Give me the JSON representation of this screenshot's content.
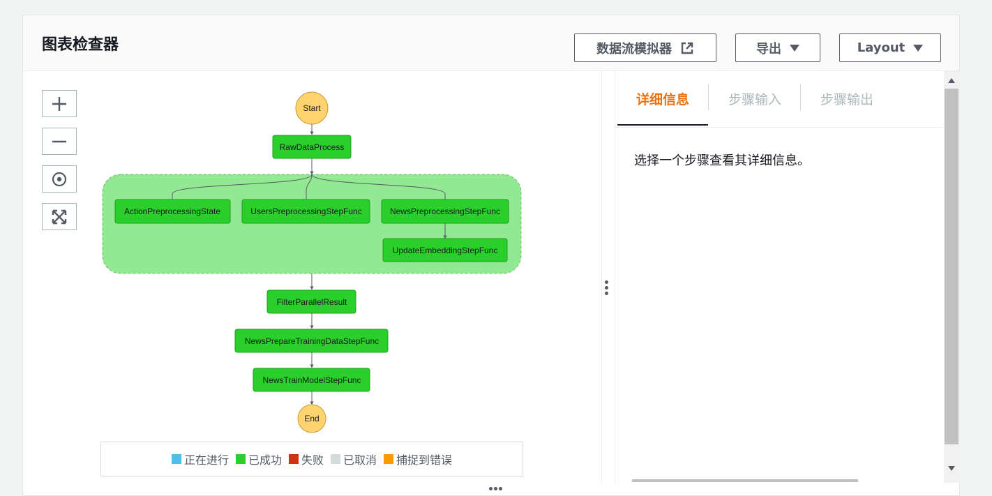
{
  "header": {
    "title": "图表检查器",
    "simulator_button": "数据流模拟器",
    "export_button": "导出",
    "layout_button": "Layout"
  },
  "zoom_controls": {
    "zoom_in_icon": "plus-icon",
    "zoom_out_icon": "minus-icon",
    "center_icon": "target-icon",
    "fit_icon": "expand-icon"
  },
  "graph": {
    "start": "Start",
    "end": "End",
    "nodes": {
      "raw": "RawDataProcess",
      "action": "ActionPreprocessingState",
      "users": "UsersPreprocessingStepFunc",
      "news": "NewsPreprocessingStepFunc",
      "update": "UpdateEmbeddingStepFunc",
      "filter": "FilterParallelResult",
      "prepare": "NewsPrepareTrainingDataStepFunc",
      "train": "NewsTrainModelStepFunc"
    }
  },
  "legend": {
    "items": [
      {
        "label": "正在进行",
        "color": "#4ec0e8"
      },
      {
        "label": "已成功",
        "color": "#2bcf2b"
      },
      {
        "label": "失败",
        "color": "#d13212"
      },
      {
        "label": "已取消",
        "color": "#d5dbdb"
      },
      {
        "label": "捕捉到错误",
        "color": "#ff9900"
      }
    ]
  },
  "details": {
    "tabs": [
      "详细信息",
      "步骤输入",
      "步骤输出"
    ],
    "empty_text": "选择一个步骤查看其详细信息。"
  },
  "colors": {
    "success_node": "#2bcf2b",
    "parallel_bg": "#93e893",
    "terminal": "#ffd470",
    "active_tab": "#ec7211"
  }
}
